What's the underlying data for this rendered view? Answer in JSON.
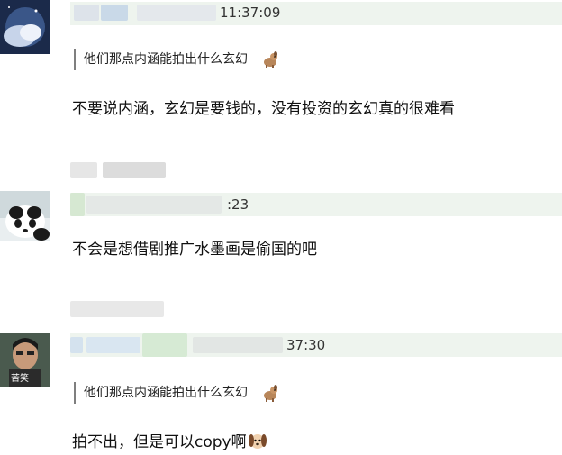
{
  "comments": [
    {
      "time": "11:37:09",
      "quote": "他们那点内涵能拍出什么玄幻",
      "quote_icon": "dog-emoji-icon",
      "text": "不要说内涵，玄幻是要钱的，没有投资的玄幻真的很难看"
    },
    {
      "time": ":23",
      "text": "不会是想借剧推广水墨画是偷国的吧"
    },
    {
      "avatar_caption": "苦笑",
      "time": "37:30",
      "quote": "他们那点内涵能拍出什么玄幻",
      "quote_icon": "dog-emoji-icon",
      "text": "拍不出，但是可以copy啊",
      "text_icon": "puppy-face-emoji-icon"
    }
  ],
  "colors": {
    "header_bar": "#eef4ee",
    "quote_border": "#7f7f7f"
  }
}
